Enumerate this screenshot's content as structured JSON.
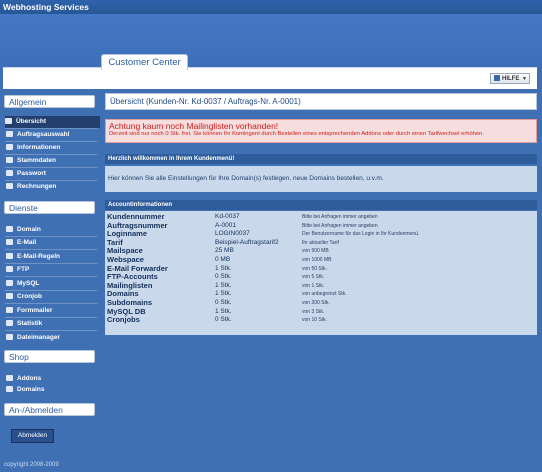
{
  "app": {
    "title": "Webhosting Services",
    "copyright": "copyright 2008-2009"
  },
  "header": {
    "tab_label": "Customer Center",
    "help_label": "HILFE"
  },
  "sidebar": {
    "sections": [
      {
        "title": "Allgemein",
        "items": [
          "Übersicht",
          "Auftragsauswahl",
          "Informationen",
          "Stammdaten",
          "Passwort",
          "Rechnungen"
        ]
      },
      {
        "title": "Dienste",
        "items": [
          "Domain",
          "E-Mail",
          "E-Mail-Regeln",
          "FTP",
          "MySQL",
          "Cronjob",
          "Formmailer",
          "Statistik",
          "Dateimanager"
        ]
      },
      {
        "title": "Shop",
        "items": [
          "Addons",
          "Domains"
        ]
      },
      {
        "title": "An-/Abmelden",
        "items": []
      }
    ],
    "logout_label": "Abmelden"
  },
  "main": {
    "title": "Übersicht (Kunden-Nr. Kd-0037 / Auftrags-Nr. A-0001)",
    "alert": {
      "heading": "Achtung kaum noch Mailinglisten vorhanden!",
      "text": "Derzeit sind nur noch 0 Stk. frei. Sie können Ihr Kontingent durch Bestellen eines entsprechenden Addons oder durch einen Tarifwechsel erhöhen."
    },
    "welcome_title": "Herzlich willkommen in Ihrem Kundenmenü!",
    "welcome_text": "Hier können Sie alle Einstellungen für Ihre Domain(s) festlegen, neue Domains bestellen, u.v.m.",
    "account_title": "Accountinformationen",
    "account_rows": [
      {
        "label": "Kundennummer",
        "value": "Kd-0037",
        "note": "Bitte bei Anfragen immer angeben"
      },
      {
        "label": "Auftragsnummer",
        "value": "A-0001",
        "note": "Bitte bei Anfragen immer angeben"
      },
      {
        "label": "Loginname",
        "value": "LOGIN0037",
        "note": "Der Benutzername für das Login in Ihr Kundenmenü."
      },
      {
        "label": "Tarif",
        "value": "Beispiel-Auftragstarif2",
        "note": "Ihr aktueller Tarif"
      },
      {
        "label": "Mailspace",
        "value": "25 MB",
        "note": "von 500 MB"
      },
      {
        "label": "Webspace",
        "value": "0 MB",
        "note": "von 1000 MB"
      },
      {
        "label": "E-Mail Forwarder",
        "value": "1 Stk.",
        "note": "von 50 Stk."
      },
      {
        "label": "FTP-Accounts",
        "value": "0 Stk.",
        "note": "von 5 Stk."
      },
      {
        "label": "Mailinglisten",
        "value": "1 Stk.",
        "note": "von 1 Stk."
      },
      {
        "label": "Domains",
        "value": "1 Stk.",
        "note": "von unbegrenzt Stk."
      },
      {
        "label": "Subdomains",
        "value": "0 Stk.",
        "note": "von 200 Stk."
      },
      {
        "label": "MySQL DB",
        "value": "1 Stk.",
        "note": "von 3 Stk."
      },
      {
        "label": "Cronjobs",
        "value": "0 Stk.",
        "note": "von 10 Stk."
      }
    ]
  }
}
